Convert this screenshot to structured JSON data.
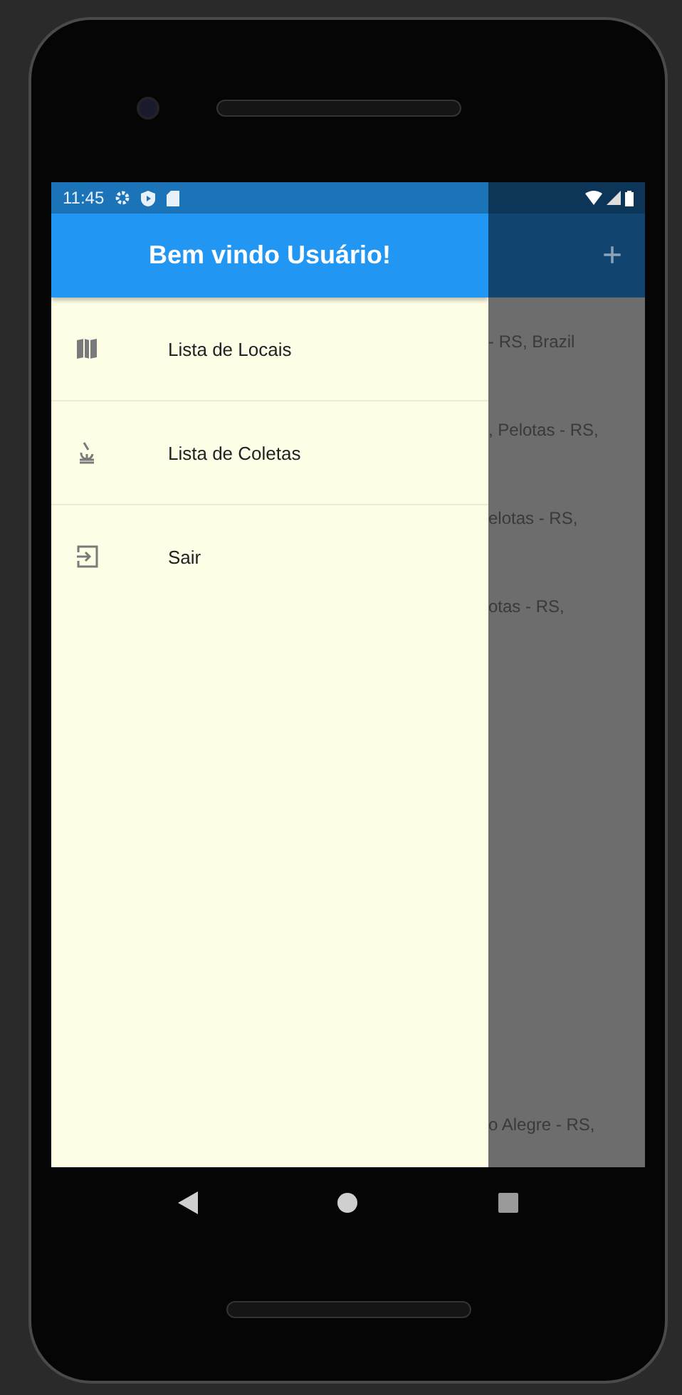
{
  "status_bar": {
    "time": "11:45"
  },
  "drawer": {
    "header": "Bem vindo Usuário!",
    "items": [
      {
        "label": "Lista de Locais",
        "kind": "places"
      },
      {
        "label": "Lista de Coletas",
        "kind": "samples"
      },
      {
        "label": "Sair",
        "kind": "logout"
      }
    ]
  },
  "background_screen": {
    "app_bar_action": "+",
    "rows": [
      {
        "text": "- RS, Brazil"
      },
      {
        "text": ", Pelotas - RS,"
      },
      {
        "text": "elotas - RS,"
      },
      {
        "text": "otas - RS,"
      },
      {
        "text": "o Alegre - RS,"
      }
    ]
  }
}
